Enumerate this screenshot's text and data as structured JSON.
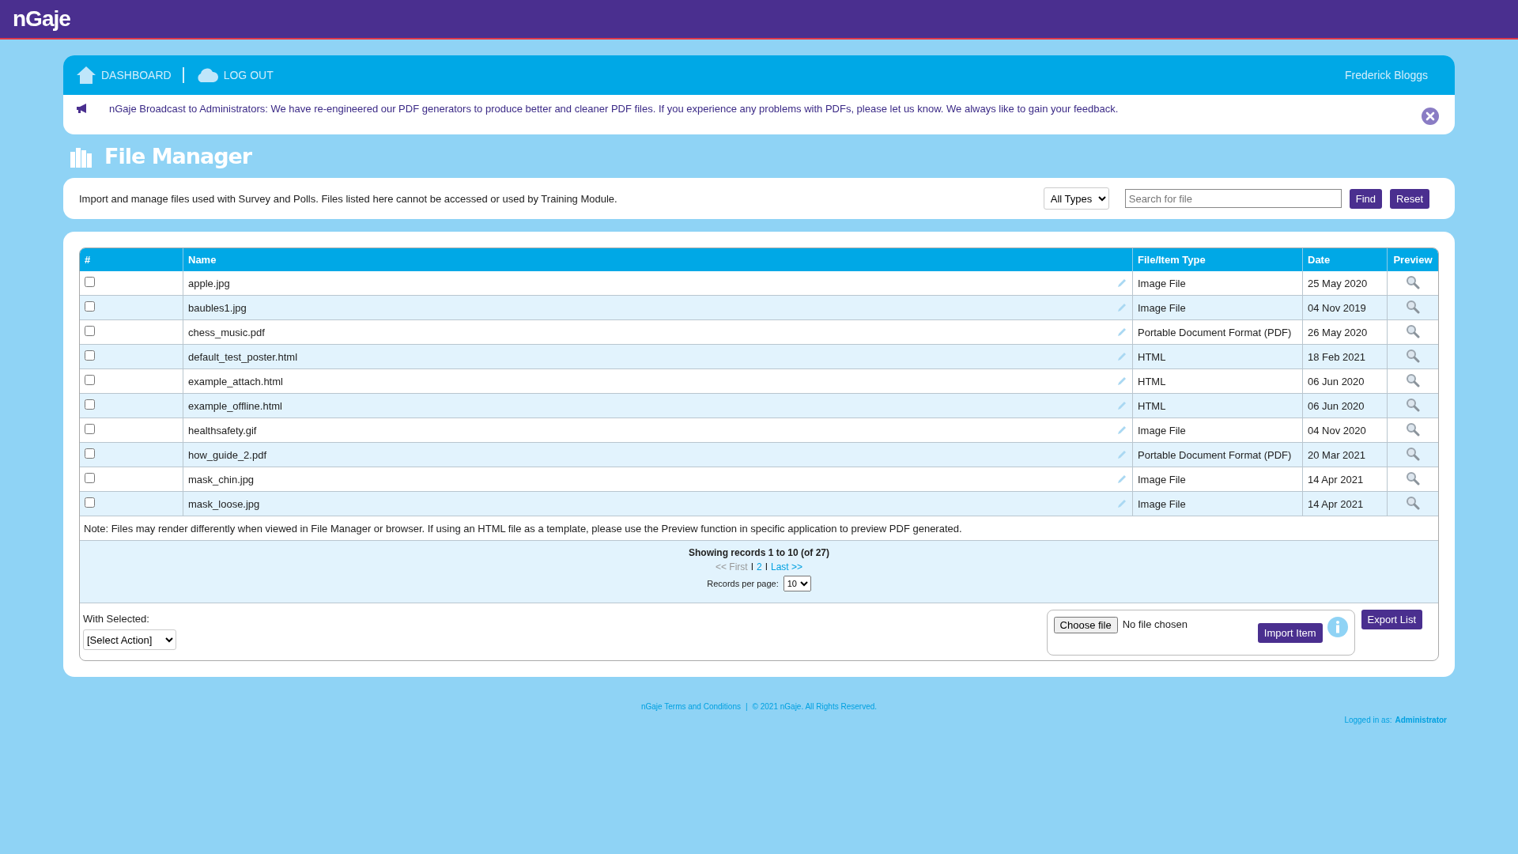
{
  "header": {
    "logo": "nGaje"
  },
  "nav": {
    "items": [
      {
        "label": "DASHBOARD",
        "kind": "home"
      },
      {
        "label": "LOG OUT",
        "kind": "cloud"
      }
    ],
    "user": "Frederick Bloggs"
  },
  "broadcast": {
    "text": "nGaje Broadcast to Administrators: We have re-engineered our PDF generators to produce better and cleaner PDF files. If you experience any problems with PDFs, please let us know. We always like to gain your feedback."
  },
  "page_title": "File Manager",
  "filter": {
    "description": "Import and manage files used with Survey and Polls. Files listed here cannot be accessed or used by Training Module.",
    "type_select": "All Types",
    "search": {
      "placeholder": "Search for file"
    },
    "buttons": [
      "Find",
      "Reset"
    ]
  },
  "table": {
    "columns": [
      "#",
      "Name",
      "File/Item Type",
      "Date",
      "Preview"
    ],
    "rows": [
      {
        "checked": false,
        "name": "apple.jpg",
        "type": "Image File",
        "date": "25 May 2020"
      },
      {
        "checked": false,
        "name": "baubles1.jpg",
        "type": "Image File",
        "date": "04 Nov 2019"
      },
      {
        "checked": false,
        "name": "chess_music.pdf",
        "type": "Portable Document Format (PDF)",
        "date": "26 May 2020"
      },
      {
        "checked": false,
        "name": "default_test_poster.html",
        "type": "HTML",
        "date": "18 Feb 2021"
      },
      {
        "checked": false,
        "name": "example_attach.html",
        "type": "HTML",
        "date": "06 Jun 2020"
      },
      {
        "checked": false,
        "name": "example_offline.html",
        "type": "HTML",
        "date": "06 Jun 2020"
      },
      {
        "checked": false,
        "name": "healthsafety.gif",
        "type": "Image File",
        "date": "04 Nov 2020"
      },
      {
        "checked": false,
        "name": "how_guide_2.pdf",
        "type": "Portable Document Format (PDF)",
        "date": "20 Mar 2021"
      },
      {
        "checked": false,
        "name": "mask_chin.jpg",
        "type": "Image File",
        "date": "14 Apr 2021"
      },
      {
        "checked": false,
        "name": "mask_loose.jpg",
        "type": "Image File",
        "date": "14 Apr 2021"
      }
    ],
    "note": "Note: Files may render differently when viewed in File Manager or browser. If using an HTML file as a template, please use the Preview function in specific application to preview PDF generated."
  },
  "pagination": {
    "summary": "Showing records 1 to 10 (of 27)",
    "links": [
      {
        "label": "<< First",
        "disabled": true
      },
      {
        "label": "2",
        "disabled": false
      },
      {
        "label": "Last >>",
        "disabled": false
      }
    ],
    "separators": [
      "I",
      "I"
    ],
    "per_page_label": "Records per page:",
    "per_page": "10"
  },
  "actions": {
    "with_selected_label": "With Selected:",
    "action_select": "[Select Action]",
    "choose_file": "Choose file",
    "file_status": "No file chosen",
    "import_button": "Import Item",
    "export_button": "Export List"
  },
  "footer": {
    "terms": "nGaje Terms and Conditions",
    "separator": "|",
    "copyright": "© 2021 nGaje. All Rights Reserved.",
    "logged_in_label": "Logged in as:",
    "logged_in_user": "Administrator"
  }
}
